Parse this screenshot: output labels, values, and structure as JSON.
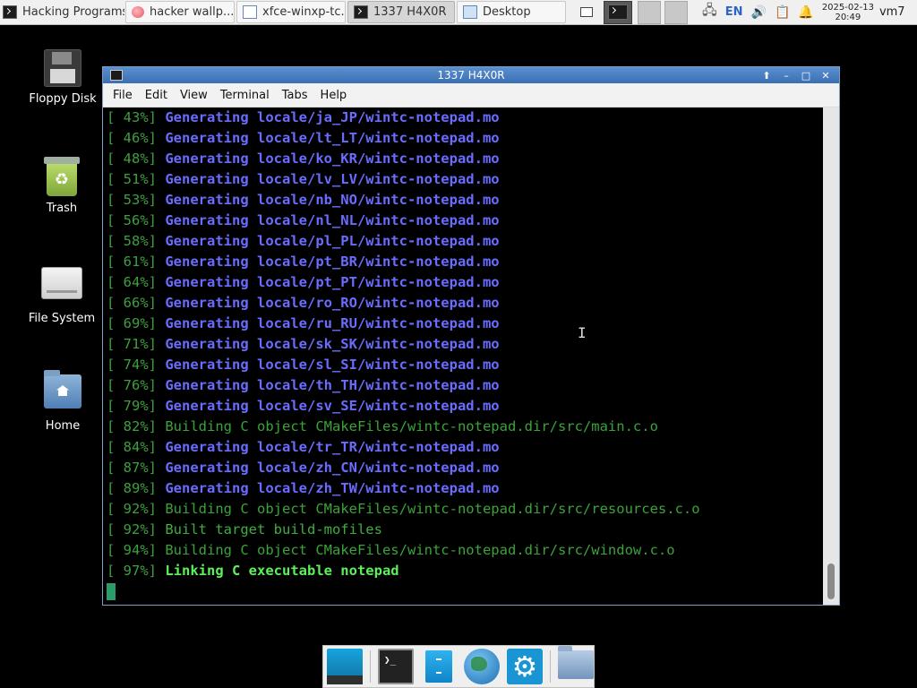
{
  "taskbar": {
    "tasks": [
      {
        "label": "Hacking Programs ☰",
        "icon": "terminal-icon"
      },
      {
        "label": "hacker wallp...",
        "icon": "browser-icon"
      },
      {
        "label": "xfce-winxp-tc...",
        "icon": "file-manager-icon"
      },
      {
        "label": "1337 H4X0R",
        "icon": "terminal-icon"
      },
      {
        "label": "Desktop",
        "icon": "desktop-icon"
      }
    ],
    "language": "EN",
    "date": "2025-02-13",
    "time": "20:49",
    "hostname": "vm7"
  },
  "desktop": {
    "icons": [
      {
        "label": "Floppy Disk"
      },
      {
        "label": "Trash"
      },
      {
        "label": "File System"
      },
      {
        "label": "Home"
      }
    ]
  },
  "window": {
    "title": "1337 H4X0R",
    "menu": [
      "File",
      "Edit",
      "View",
      "Terminal",
      "Tabs",
      "Help"
    ]
  },
  "terminal": {
    "lines": [
      {
        "pct": "[ 43%]",
        "text": "Generating locale/ja_JP/wintc-notepad.mo",
        "style": "gen"
      },
      {
        "pct": "[ 46%]",
        "text": "Generating locale/lt_LT/wintc-notepad.mo",
        "style": "gen"
      },
      {
        "pct": "[ 48%]",
        "text": "Generating locale/ko_KR/wintc-notepad.mo",
        "style": "gen"
      },
      {
        "pct": "[ 51%]",
        "text": "Generating locale/lv_LV/wintc-notepad.mo",
        "style": "gen"
      },
      {
        "pct": "[ 53%]",
        "text": "Generating locale/nb_NO/wintc-notepad.mo",
        "style": "gen"
      },
      {
        "pct": "[ 56%]",
        "text": "Generating locale/nl_NL/wintc-notepad.mo",
        "style": "gen"
      },
      {
        "pct": "[ 58%]",
        "text": "Generating locale/pl_PL/wintc-notepad.mo",
        "style": "gen"
      },
      {
        "pct": "[ 61%]",
        "text": "Generating locale/pt_BR/wintc-notepad.mo",
        "style": "gen"
      },
      {
        "pct": "[ 64%]",
        "text": "Generating locale/pt_PT/wintc-notepad.mo",
        "style": "gen"
      },
      {
        "pct": "[ 66%]",
        "text": "Generating locale/ro_RO/wintc-notepad.mo",
        "style": "gen"
      },
      {
        "pct": "[ 69%]",
        "text": "Generating locale/ru_RU/wintc-notepad.mo",
        "style": "gen"
      },
      {
        "pct": "[ 71%]",
        "text": "Generating locale/sk_SK/wintc-notepad.mo",
        "style": "gen"
      },
      {
        "pct": "[ 74%]",
        "text": "Generating locale/sl_SI/wintc-notepad.mo",
        "style": "gen"
      },
      {
        "pct": "[ 76%]",
        "text": "Generating locale/th_TH/wintc-notepad.mo",
        "style": "gen"
      },
      {
        "pct": "[ 79%]",
        "text": "Generating locale/sv_SE/wintc-notepad.mo",
        "style": "gen"
      },
      {
        "pct": "[ 82%]",
        "text": "Building C object CMakeFiles/wintc-notepad.dir/src/main.c.o",
        "style": "build"
      },
      {
        "pct": "[ 84%]",
        "text": "Generating locale/tr_TR/wintc-notepad.mo",
        "style": "gen"
      },
      {
        "pct": "[ 87%]",
        "text": "Generating locale/zh_CN/wintc-notepad.mo",
        "style": "gen"
      },
      {
        "pct": "[ 89%]",
        "text": "Generating locale/zh_TW/wintc-notepad.mo",
        "style": "gen"
      },
      {
        "pct": "[ 92%]",
        "text": "Building C object CMakeFiles/wintc-notepad.dir/src/resources.c.o",
        "style": "build"
      },
      {
        "pct": "[ 92%]",
        "text": "Built target build-mofiles",
        "style": "built"
      },
      {
        "pct": "[ 94%]",
        "text": "Building C object CMakeFiles/wintc-notepad.dir/src/window.c.o",
        "style": "build"
      },
      {
        "pct": "[ 97%]",
        "text": "Linking C executable notepad",
        "style": "link"
      }
    ]
  },
  "colors": {
    "generating": "#6a6cff",
    "building": "#3aa33a",
    "linking": "#5cf05c",
    "titlebar": "#4a80c4"
  }
}
